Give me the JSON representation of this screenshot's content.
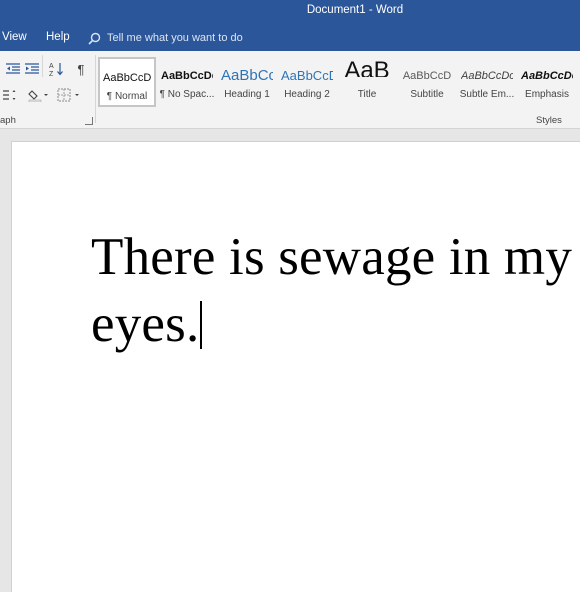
{
  "window": {
    "title": "Document1  -  Word"
  },
  "menu": {
    "items": [
      "View",
      "Help"
    ]
  },
  "tell_me": {
    "placeholder": "Tell me what you want to do"
  },
  "ribbon": {
    "paragraph_group_label": "aph",
    "styles_group_label": "Styles",
    "styles": [
      {
        "preview": "AaBbCcDc",
        "label": "¶ Normal",
        "color": "#111111",
        "selected": true
      },
      {
        "preview": "AaBbCcDc",
        "label": "¶ No Spac...",
        "color": "#111111",
        "selected": false
      },
      {
        "preview": "AaBbCc",
        "label": "Heading 1",
        "color": "#2e74b5",
        "selected": false
      },
      {
        "preview": "AaBbCcD",
        "label": "Heading 2",
        "color": "#2e74b5",
        "selected": false
      },
      {
        "preview": "AaB",
        "label": "Title",
        "color": "#111111",
        "selected": false
      },
      {
        "preview": "AaBbCcD",
        "label": "Subtitle",
        "color": "#595959",
        "selected": false
      },
      {
        "preview": "AaBbCcDc",
        "label": "Subtle Em...",
        "color": "#404040",
        "selected": false
      },
      {
        "preview": "AaBbCcDc",
        "label": "Emphasis",
        "color": "#111111",
        "selected": false
      }
    ]
  },
  "document": {
    "lines": [
      "There is sewage in my",
      "eyes."
    ]
  },
  "colors": {
    "accent": "#2b579a",
    "ribbon_bg": "#f3f3f3",
    "doc_bg": "#e6e6e6"
  },
  "icons": [
    "search-icon",
    "decrease-indent-icon",
    "increase-indent-icon",
    "sort-icon",
    "pilcrow-icon",
    "line-spacing-icon",
    "shading-icon",
    "borders-icon",
    "dialog-launcher-icon"
  ]
}
